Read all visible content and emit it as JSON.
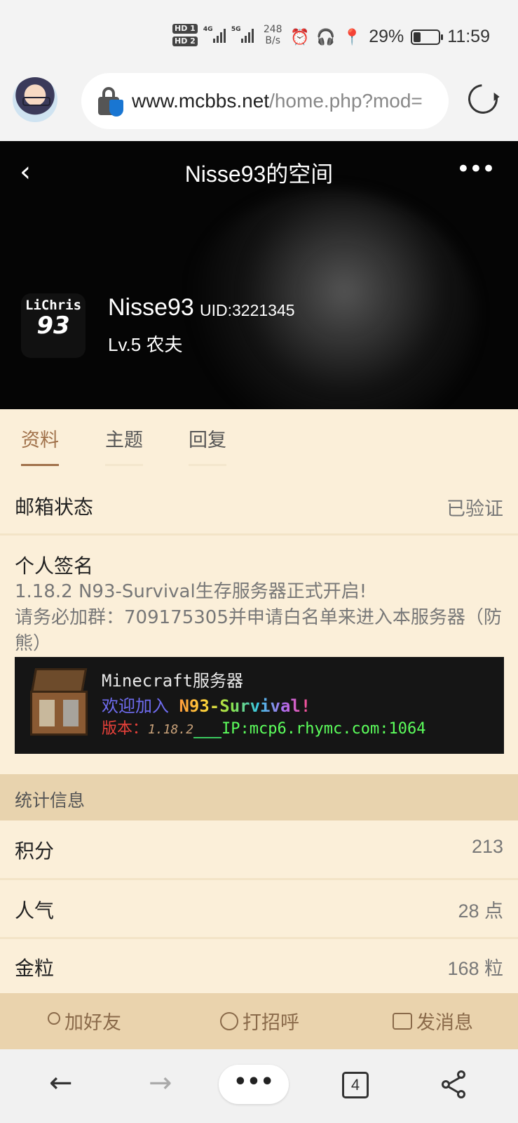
{
  "status_bar": {
    "hd1": "HD 1",
    "hd2": "HD 2",
    "net1": "4G",
    "net2": "5G",
    "speed_value": "248",
    "speed_unit": "B/s",
    "battery": "29%",
    "battery_level": 29,
    "time": "11:59"
  },
  "browser": {
    "url_domain": "www.mcbbs.net",
    "url_path": "/home.php?mod="
  },
  "header": {
    "title": "Nisse93的空间",
    "avatar_line1": "LiChris",
    "avatar_line2": "93",
    "username": "Nisse93",
    "uid": "UID:3221345",
    "level": "Lv.5 农夫"
  },
  "tabs": [
    {
      "label": "资料",
      "active": true
    },
    {
      "label": "主题",
      "active": false
    },
    {
      "label": "回复",
      "active": false
    }
  ],
  "profile": {
    "email_label": "邮箱状态",
    "email_value": "已验证",
    "signature_label": "个人签名",
    "signature_lines": [
      "1.18.2 N93-Survival生存服务器正式开启!",
      "请务必加群：709175305并申请白名单来进入本服务器（防熊）"
    ],
    "banner": {
      "line1": "Minecraft服务器",
      "line2_a": "欢迎加入",
      "line2_b": "N93-Survival!",
      "line3_a": "版本：",
      "line3_ver": "1.18.2",
      "line3_b": "IP:mcp6.rhymc.com:1064"
    }
  },
  "stats": {
    "heading": "统计信息",
    "items": [
      {
        "label": "积分",
        "value": "213"
      },
      {
        "label": "人气",
        "value": "28 点"
      },
      {
        "label": "金粒",
        "value": "168 粒"
      }
    ]
  },
  "actions": {
    "add_friend": "加好友",
    "greet": "打招呼",
    "message": "发消息"
  },
  "bottom_nav": {
    "more": "•••",
    "tab_count": "4"
  },
  "colors": {
    "page_bg": "#fbefd9",
    "accent": "#a0714a",
    "stat_header_bg": "#e8d3ae",
    "action_bar_bg": "#ead3ad"
  }
}
